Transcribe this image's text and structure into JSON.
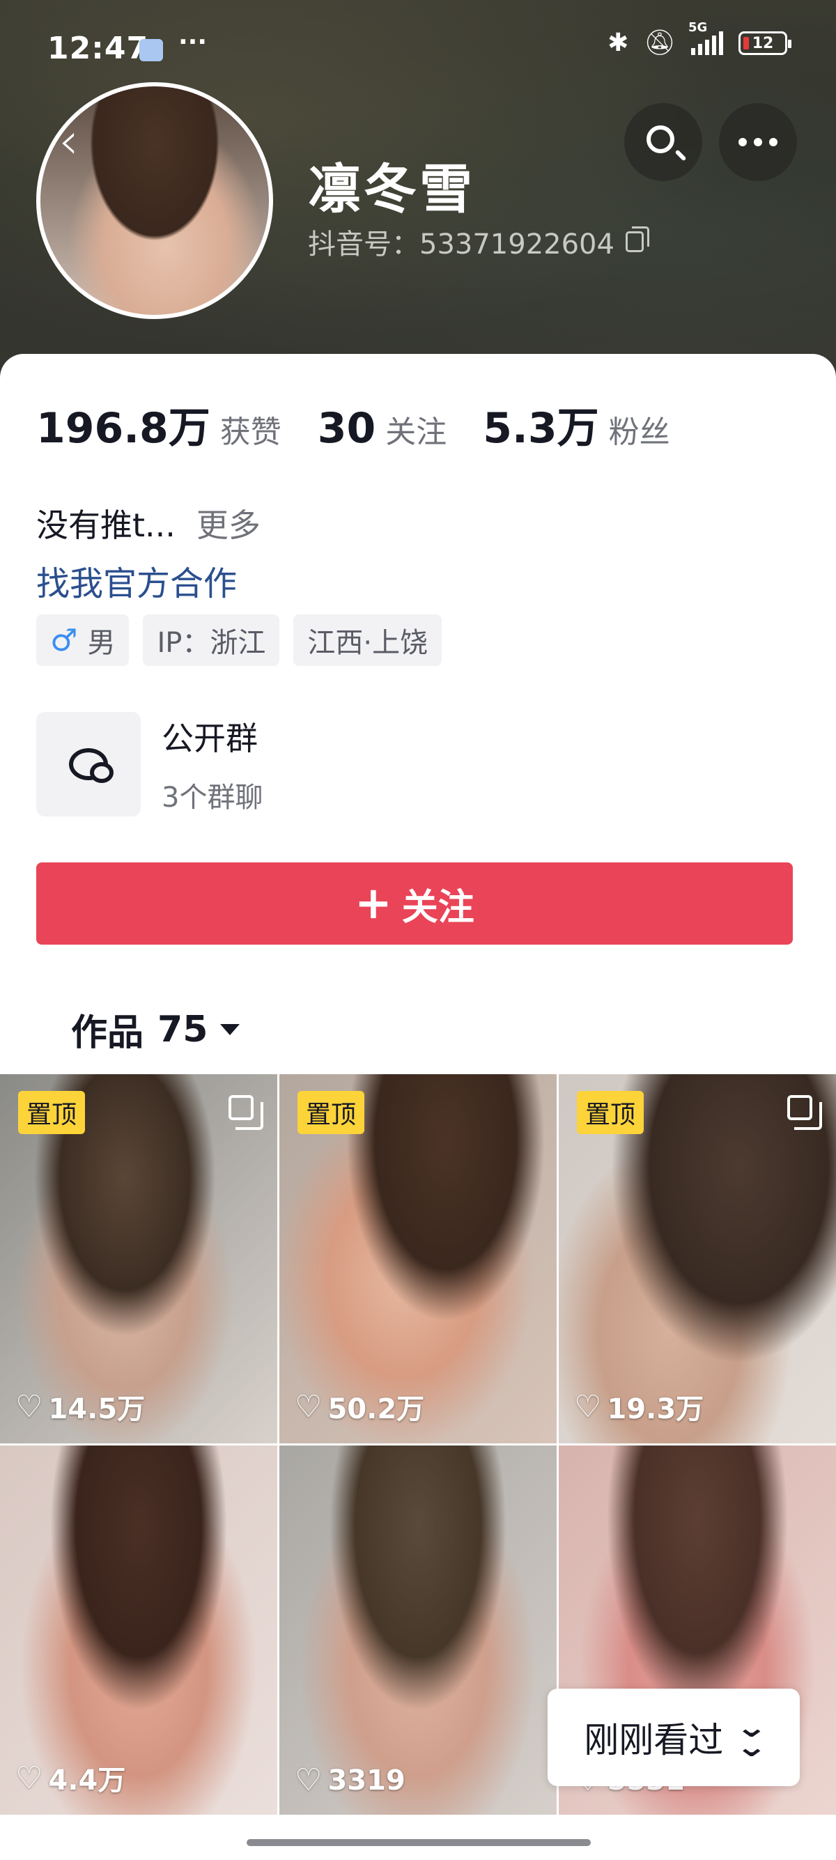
{
  "status_bar": {
    "time": "12:47",
    "overflow": "···",
    "network": "5G",
    "battery": "12",
    "icons": [
      "app-notification-icon",
      "bluetooth-icon",
      "mute-icon",
      "signal-icon",
      "battery-icon"
    ]
  },
  "profile": {
    "name": "凛冬雪",
    "id_label": "抖音号：53371922604"
  },
  "stats": [
    {
      "value": "196.8万",
      "label": "获赞"
    },
    {
      "value": "30",
      "label": "关注"
    },
    {
      "value": "5.3万",
      "label": "粉丝"
    }
  ],
  "bio": {
    "text": "没有推t...",
    "more": "更多"
  },
  "collab_link": "找我官方合作",
  "tags": {
    "gender_icon": "♂",
    "gender": "男",
    "ip": "IP：浙江",
    "location": "江西·上饶"
  },
  "group": {
    "title": "公开群",
    "subtitle": "3个群聊"
  },
  "follow_button": {
    "icon": "+",
    "label": "关注"
  },
  "works": {
    "label": "作品",
    "count": "75"
  },
  "grid": [
    {
      "likes": "14.5万",
      "pinned": true,
      "pin_label": "置顶",
      "multi": true
    },
    {
      "likes": "50.2万",
      "pinned": true,
      "pin_label": "置顶",
      "multi": false
    },
    {
      "likes": "19.3万",
      "pinned": true,
      "pin_label": "置顶",
      "multi": true
    },
    {
      "likes": "4.4万",
      "pinned": false
    },
    {
      "likes": "3319",
      "pinned": false
    },
    {
      "likes": "5531",
      "pinned": false
    }
  ],
  "recently_viewed": "刚刚看过",
  "colors": {
    "follow_button": "#ea4458",
    "link": "#2b4f8e",
    "pin_badge": "#fdd33a",
    "gender_icon": "#3a8ef0"
  }
}
